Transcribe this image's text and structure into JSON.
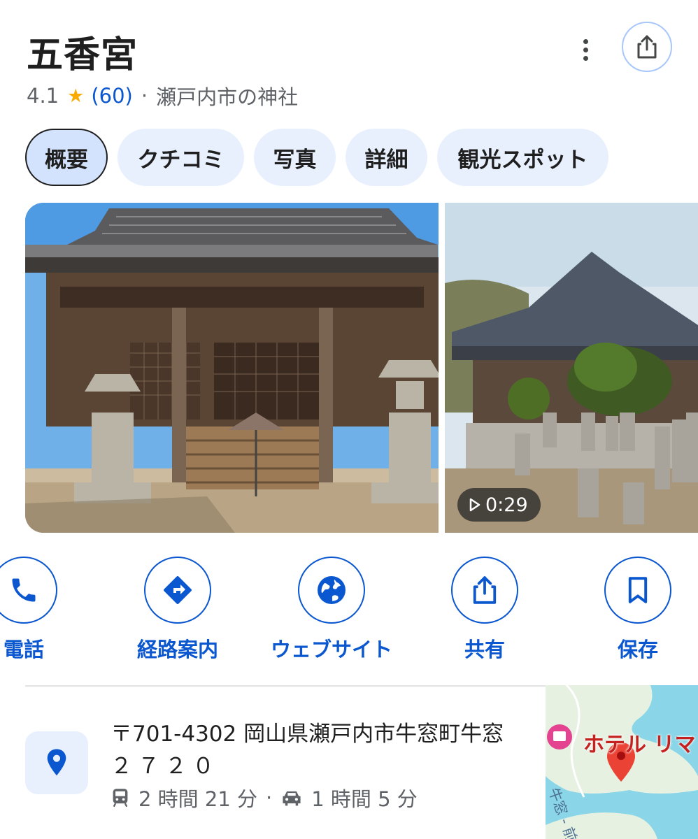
{
  "place": {
    "name": "五香宮",
    "rating": "4.1",
    "review_count": "(60)",
    "separator": "·",
    "category": "瀬戸内市の神社"
  },
  "tabs": [
    {
      "label": "概要",
      "active": true
    },
    {
      "label": "クチコミ"
    },
    {
      "label": "写真"
    },
    {
      "label": "詳細"
    },
    {
      "label": "観光スポット"
    }
  ],
  "photos": {
    "video_duration": "0:29"
  },
  "actions": [
    {
      "label": "電話",
      "icon": "phone-icon"
    },
    {
      "label": "経路案内",
      "icon": "directions-icon"
    },
    {
      "label": "ウェブサイト",
      "icon": "globe-icon"
    },
    {
      "label": "共有",
      "icon": "share-icon"
    },
    {
      "label": "保存",
      "icon": "bookmark-icon"
    }
  ],
  "address": {
    "line1": "〒701-4302 岡山県瀬戸内市牛窓町牛窓",
    "line2": "２７２０",
    "transit_time": "2 時間 21 分",
    "separator": "·",
    "drive_time": "1 時間 5 分"
  },
  "map": {
    "hotel_label": "ホテル リマ",
    "road_label": "牛窓 - 前"
  },
  "colors": {
    "accent_blue": "#0b57d0",
    "chip_bg": "#e8f0fe",
    "star": "#f9ab00",
    "pin_red": "#ea4335"
  }
}
